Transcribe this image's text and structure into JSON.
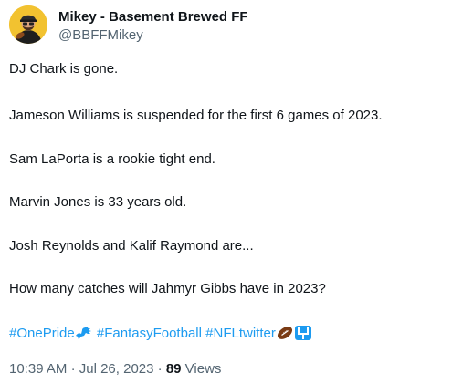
{
  "author": {
    "display_name": "Mikey - Basement Brewed FF",
    "handle": "@BBFFMikey"
  },
  "tweet": {
    "lines": [
      "DJ Chark is gone.",
      "Jameson Williams is suspended for the first 6 games of 2023.",
      "Sam LaPorta is a rookie tight end.",
      "Marvin Jones is 33 years old.",
      "Josh Reynolds and Kalif Raymond are...",
      "How many catches will Jahmyr Gibbs have in 2023?"
    ],
    "hashtags": [
      "#OnePride",
      "#FantasyFootball",
      "#NFLtwitter"
    ]
  },
  "meta": {
    "time": "10:39 AM",
    "separator": "·",
    "date": "Jul 26, 2023",
    "views_count": "89",
    "views_label": "Views"
  },
  "colors": {
    "link": "#1d9bf0",
    "secondary_text": "#536471",
    "primary_text": "#0f1419",
    "avatar_bg": "#f2c230"
  },
  "icons": [
    "avatar",
    "lion-icon",
    "football-icon",
    "goalpost-icon"
  ]
}
